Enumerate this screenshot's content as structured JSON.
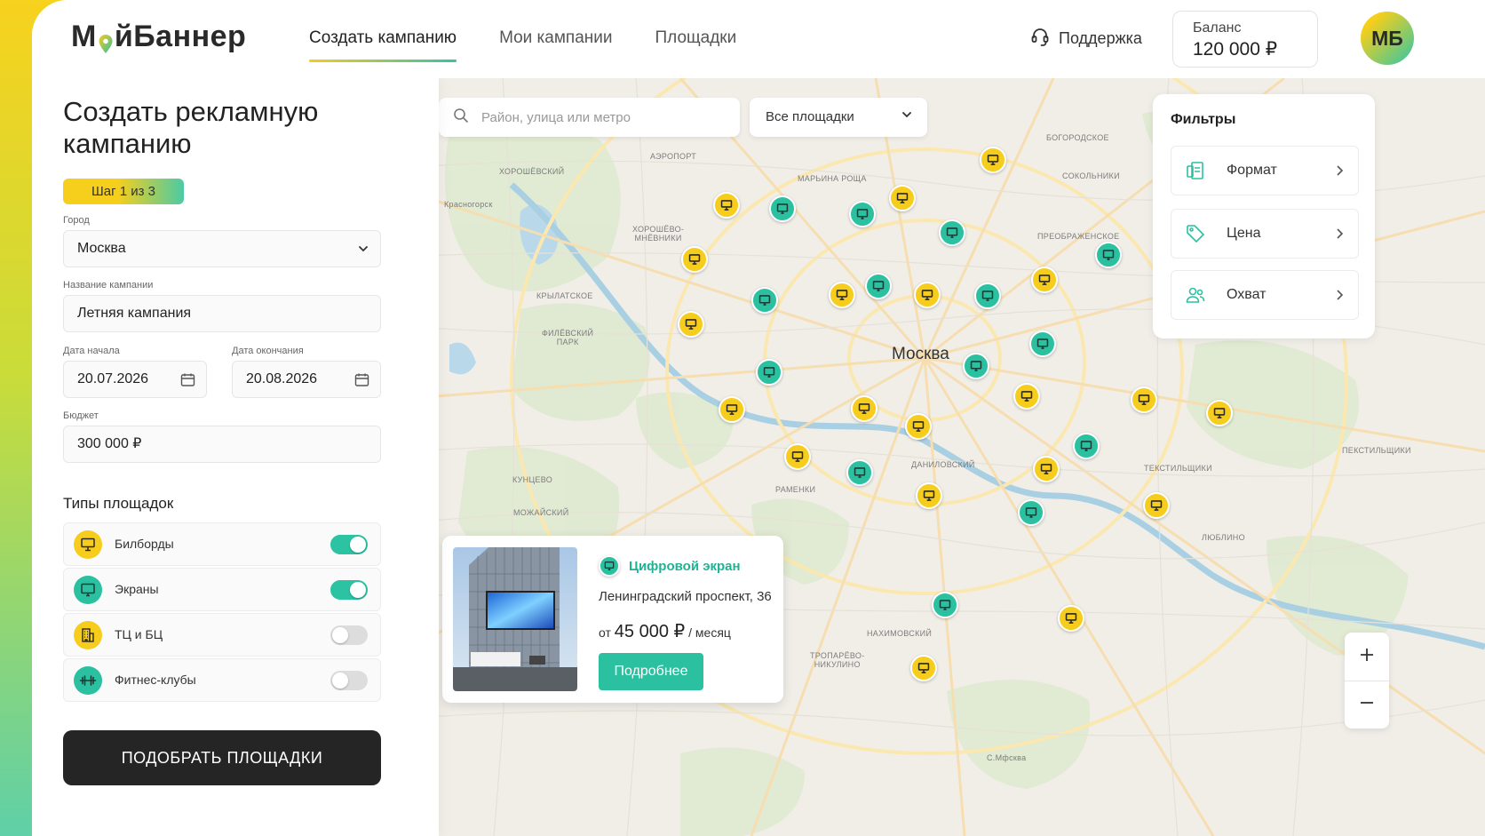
{
  "header": {
    "logo": {
      "part1": "М",
      "part2": "йБаннер"
    },
    "nav": [
      {
        "label": "Создать кампанию",
        "active": true
      },
      {
        "label": "Мои кампании",
        "active": false
      },
      {
        "label": "Площадки",
        "active": false
      }
    ],
    "support_label": "Поддержка",
    "balance": {
      "label": "Баланс",
      "value": "120 000 ₽"
    },
    "avatar_initials": "МБ"
  },
  "form": {
    "title": "Создать рекламную кампанию",
    "step": "Шаг 1 из 3",
    "city": {
      "label": "Город",
      "value": "Москва"
    },
    "campaign_name": {
      "label": "Название кампании",
      "value": "Летняя кампания"
    },
    "start_date": {
      "label": "Дата начала",
      "value": "20.07.2026"
    },
    "end_date": {
      "label": "Дата окончания",
      "value": "20.08.2026"
    },
    "budget": {
      "label": "Бюджет",
      "value": "300 000 ₽"
    },
    "types_title": "Типы площадок",
    "types": [
      {
        "label": "Билборды",
        "icon": "billboard-icon",
        "enabled": true
      },
      {
        "label": "Экраны",
        "icon": "screen-icon",
        "enabled": true
      },
      {
        "label": "ТЦ и БЦ",
        "icon": "building-icon",
        "enabled": false
      },
      {
        "label": "Фитнес-клубы",
        "icon": "dumbbell-icon",
        "enabled": false
      }
    ],
    "submit_label": "ПОДОБРАТЬ ПЛОЩАДКИ"
  },
  "map": {
    "search_placeholder": "Район, улица или метро",
    "placement_select": "Все площадки",
    "city_label": "Москва",
    "districts": [
      {
        "name": "БОГОРОДСКОЕ"
      },
      {
        "name": "АЭРОПОРТ"
      },
      {
        "name": "ХОРОШЁВСКИЙ"
      },
      {
        "name": "МАРЬИНА РОЩА"
      },
      {
        "name": "СОКОЛЬНИКИ"
      },
      {
        "name": "Красногорск"
      },
      {
        "name": "ХОРОШЁВО-\nМНЁВНИКИ"
      },
      {
        "name": "ПРЕОБРАЖЕНСКОЕ"
      },
      {
        "name": "КРЫЛАТСКОЕ"
      },
      {
        "name": "ФИЛЁВСКИЙ\nПАРК"
      },
      {
        "name": "ПЕКСТИЛЬЩИКИ"
      },
      {
        "name": "ДАНИЛОВСКИЙ"
      },
      {
        "name": "ТЕКСТИЛЬЩИКИ"
      },
      {
        "name": "КУНЦЕВО"
      },
      {
        "name": "РАМЕНКИ"
      },
      {
        "name": "МОЖАЙСКИЙ"
      },
      {
        "name": "ЛЮБЛИНО"
      },
      {
        "name": "НАХИМОВСКИЙ"
      },
      {
        "name": "ТРОПАРЁВО-\nНИКУЛИНО"
      },
      {
        "name": "С.Мфсква"
      }
    ],
    "filters": {
      "title": "Фильтры",
      "items": [
        {
          "label": "Формат",
          "icon": "format-icon"
        },
        {
          "label": "Цена",
          "icon": "price-tag-icon"
        },
        {
          "label": "Охват",
          "icon": "audience-icon"
        }
      ]
    },
    "card": {
      "type": "Цифровой экран",
      "address": "Ленинградский проспект, 36",
      "price_prefix": "от",
      "price_value": "45 000 ₽",
      "price_suffix": "/ месяц",
      "button_label": "Подробнее"
    },
    "zoom": {
      "in": "+",
      "out": "−"
    }
  },
  "colors": {
    "accent_yellow": "#f6cc1d",
    "accent_green": "#2bc1a0",
    "dark_button": "#252525"
  }
}
